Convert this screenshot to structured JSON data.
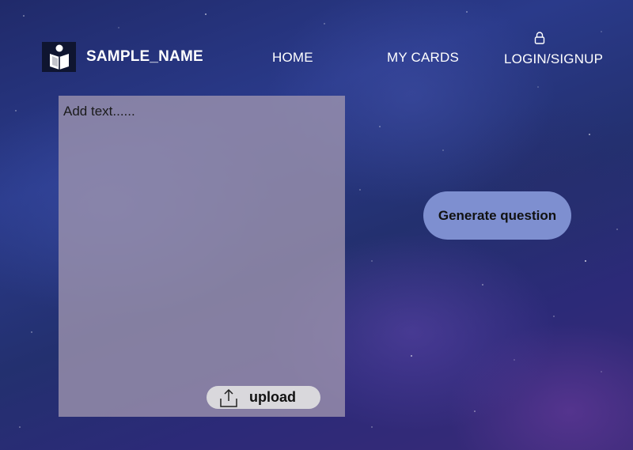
{
  "header": {
    "brand_name": "SAMPLE_NAME",
    "logo_icon": "reading-person-icon",
    "nav": {
      "home": "HOME",
      "my_cards": "MY CARDS",
      "login": "LOGIN/SIGNUP",
      "login_icon": "lock-icon"
    }
  },
  "editor": {
    "placeholder": "Add text......",
    "value": "",
    "upload_label": "upload",
    "upload_icon": "upload-icon"
  },
  "actions": {
    "generate_label": "Generate question"
  },
  "colors": {
    "panel": "#a096af",
    "generate_button": "#7e8fd0",
    "upload_button": "#d9d8dc",
    "logo_background": "#0f1530"
  }
}
